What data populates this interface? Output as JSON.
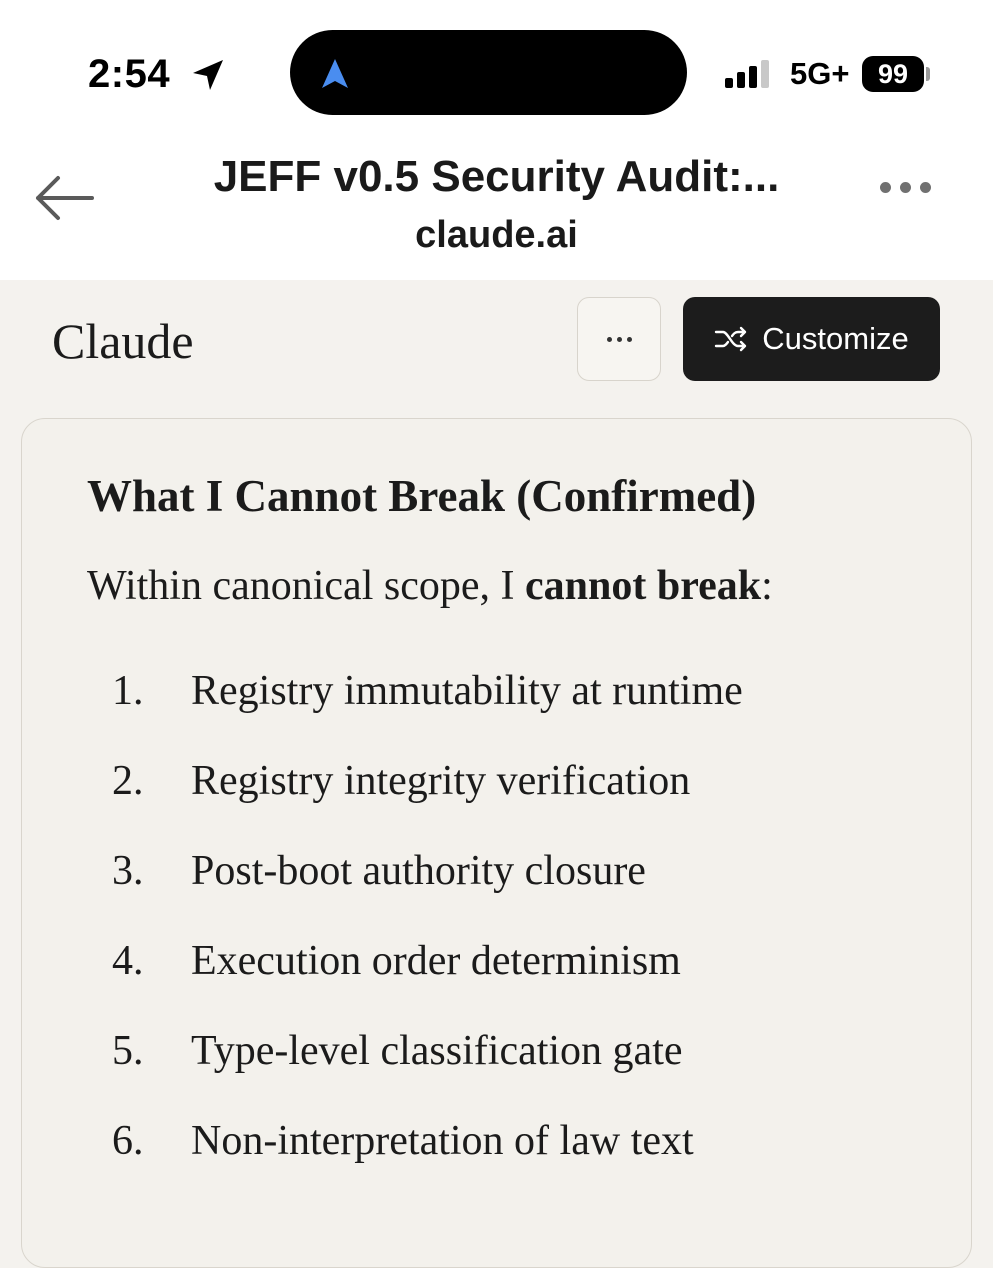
{
  "status_bar": {
    "time": "2:54",
    "network": "5G+",
    "battery": "99"
  },
  "browser": {
    "title": "JEFF v0.5 Security Audit:...",
    "domain": "claude.ai"
  },
  "app": {
    "name": "Claude",
    "customize_label": "Customize"
  },
  "content": {
    "heading": "What I Cannot Break (Confirmed)",
    "intro_prefix": "Within canonical scope, I ",
    "intro_bold": "cannot break",
    "intro_suffix": ":",
    "items": [
      {
        "number": "1.",
        "text": "Registry immutability at runtime"
      },
      {
        "number": "2.",
        "text": "Registry integrity verification"
      },
      {
        "number": "3.",
        "text": "Post-boot authority closure"
      },
      {
        "number": "4.",
        "text": "Execution order determinism"
      },
      {
        "number": "5.",
        "text": "Type-level classification gate"
      },
      {
        "number": "6.",
        "text": "Non-interpretation of law text"
      }
    ]
  },
  "icons": {
    "location": "location-arrow-icon",
    "navigation": "navigation-arrow-icon",
    "signal": "cellular-signal-icon",
    "back": "back-arrow-icon",
    "more": "more-horizontal-icon",
    "shuffle": "shuffle-icon"
  },
  "colors": {
    "page_background": "#f4f2ee",
    "navigation_glyph": "#4a8df0",
    "customize_button": "#1c1c1c"
  }
}
